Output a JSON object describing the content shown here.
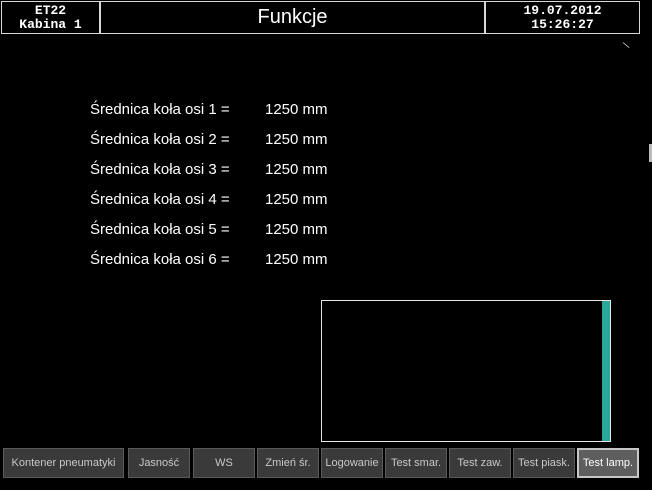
{
  "header": {
    "device_line1": "ET22",
    "device_line2": "Kabina 1",
    "title": "Funkcje",
    "date": "19.07.2012",
    "time": "15:26:27"
  },
  "axles": [
    {
      "label": "Średnica koła osi 1 =",
      "value": "1250 mm"
    },
    {
      "label": "Średnica koła osi 2 =",
      "value": "1250 mm"
    },
    {
      "label": "Średnica koła osi 3 =",
      "value": "1250 mm"
    },
    {
      "label": "Średnica koła osi 4 =",
      "value": "1250 mm"
    },
    {
      "label": "Średnica koła osi 5 =",
      "value": "1250 mm"
    },
    {
      "label": "Średnica koła osi 6 =",
      "value": "1250 mm"
    }
  ],
  "panel": {
    "accent_color": "#2aa69a"
  },
  "tabs": [
    {
      "label": "Kontener pneumatyki",
      "active": false
    },
    {
      "label": "Jasność",
      "active": false
    },
    {
      "label": "WS",
      "active": false
    },
    {
      "label": "Zmień śr.",
      "active": false
    },
    {
      "label": "Logowanie",
      "active": false
    },
    {
      "label": "Test smar.",
      "active": false
    },
    {
      "label": "Test zaw.",
      "active": false
    },
    {
      "label": "Test piask.",
      "active": false
    },
    {
      "label": "Test lamp.",
      "active": true
    }
  ]
}
